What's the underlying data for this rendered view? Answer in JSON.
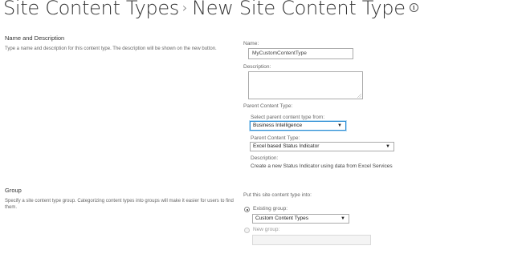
{
  "header": {
    "breadcrumb_parent": "Site Content Types",
    "separator": "›",
    "page_title": "New Site Content Type",
    "info_glyph": "i"
  },
  "name_section": {
    "title": "Name and Description",
    "description": "Type a name and description for this content type. The description will be shown on the new button.",
    "name_label": "Name:",
    "name_value": "MyCustomContentType",
    "description_label": "Description:",
    "description_value": ""
  },
  "parent_section": {
    "heading": "Parent Content Type:",
    "select_from_label": "Select parent content type from:",
    "select_from_value": "Business Intelligence",
    "parent_label": "Parent Content Type:",
    "parent_value": "Excel based Status Indicator",
    "desc_label": "Description:",
    "desc_value": "Create a new Status Indicator using data from Excel Services"
  },
  "group_section": {
    "title": "Group",
    "description": "Specify a site content type group. Categorizing content types into groups will make it easier for users to find them.",
    "put_into_label": "Put this site content type into:",
    "existing_group_label": "Existing group:",
    "existing_group_value": "Custom Content Types",
    "new_group_label": "New group:",
    "new_group_value": ""
  },
  "colors": {
    "focus_border": "#2a8dd4",
    "text": "#444444",
    "label": "#666666"
  },
  "icons": {
    "info": "info-circle-icon",
    "dropdown": "chevron-down-icon",
    "resize": "resize-grip-icon"
  }
}
